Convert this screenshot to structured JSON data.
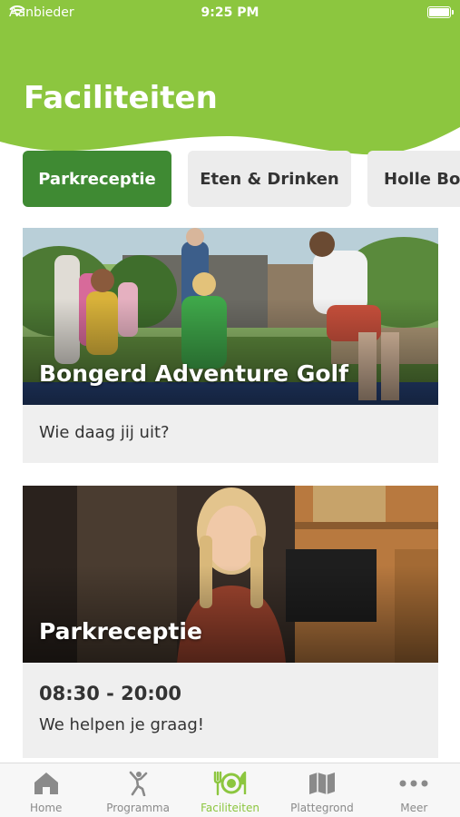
{
  "status_bar": {
    "carrier": "Aanbieder",
    "time": "9:25 PM"
  },
  "header": {
    "title": "Faciliteiten",
    "bg_color": "#8cc63f"
  },
  "tabs": [
    {
      "label": "Parkreceptie",
      "active": true
    },
    {
      "label": "Eten & Drinken",
      "active": false
    },
    {
      "label": "Holle Bol",
      "active": false
    }
  ],
  "cards": [
    {
      "title": "Bongerd Adventure Golf",
      "description": "Wie daag jij uit?"
    },
    {
      "title": "Parkreceptie",
      "hours": "08:30 - 20:00",
      "description": "We helpen je graag!"
    }
  ],
  "bottom_nav": [
    {
      "label": "Home",
      "icon": "home-icon",
      "active": false
    },
    {
      "label": "Programma",
      "icon": "dancer-icon",
      "active": false
    },
    {
      "label": "Faciliteiten",
      "icon": "cutlery-icon",
      "active": true
    },
    {
      "label": "Plattegrond",
      "icon": "map-icon",
      "active": false
    },
    {
      "label": "Meer",
      "icon": "more-icon",
      "active": false
    }
  ],
  "colors": {
    "accent": "#8cc63f",
    "active_tab": "#3f8a33",
    "inactive_nav": "#8a8a8a"
  }
}
